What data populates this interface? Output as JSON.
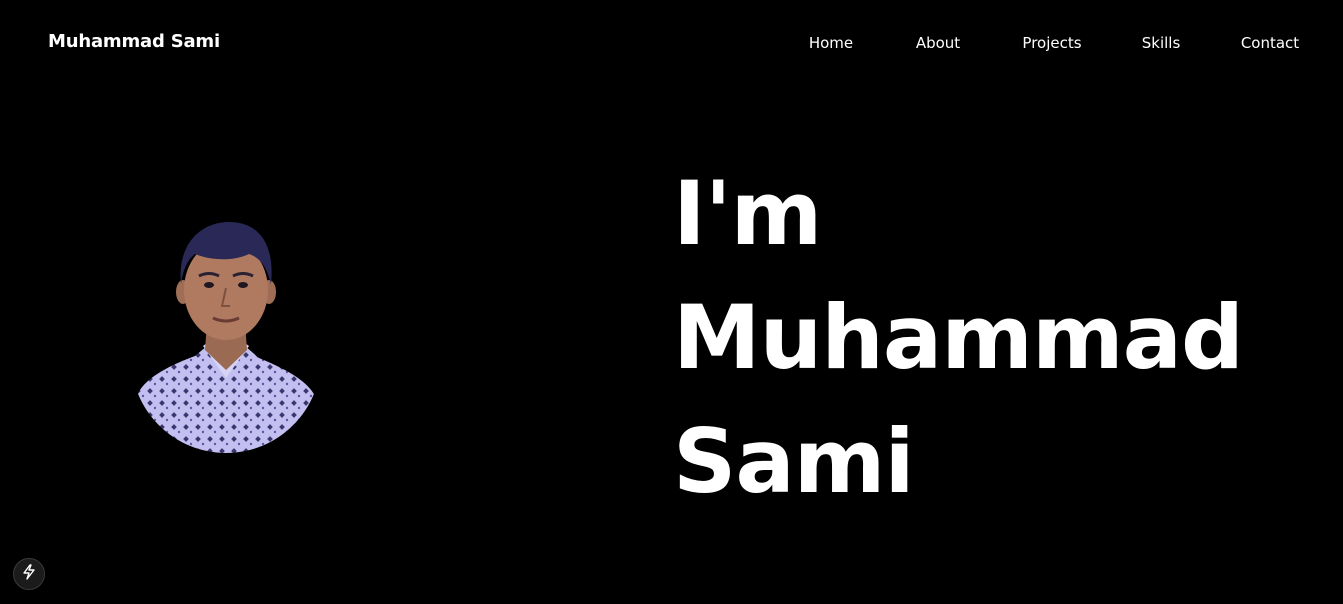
{
  "brand": {
    "name": "Muhammad Sami"
  },
  "nav": {
    "items": [
      {
        "label": "Home"
      },
      {
        "label": "About"
      },
      {
        "label": "Projects"
      },
      {
        "label": "Skills"
      },
      {
        "label": "Contact"
      }
    ]
  },
  "hero": {
    "line1": "I'm",
    "line2": "Muhammad",
    "line3": "Sami",
    "avatar": "profile-photo"
  },
  "dev_badge": {
    "icon": "lightning-bolt-icon"
  },
  "colors": {
    "background": "#000000",
    "text": "#ffffff",
    "shirt": "#b7b2e6",
    "hair": "#2a2856"
  }
}
